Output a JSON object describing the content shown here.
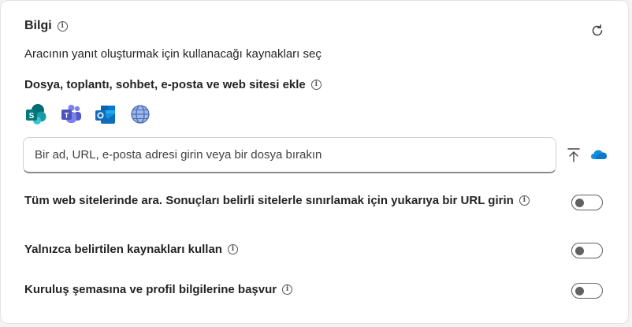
{
  "header": {
    "title": "Bilgi",
    "info_icon": "info-icon",
    "refresh_icon": "refresh-icon"
  },
  "subtitle": "Aracının yanıt oluşturmak için kullanacağı kaynakları seç",
  "add_section": {
    "label": "Dosya, toplantı, sohbet, e-posta ve web sitesi ekle",
    "sources": [
      "sharepoint-icon",
      "teams-icon",
      "outlook-icon",
      "globe-icon"
    ]
  },
  "search": {
    "placeholder": "Bir ad, URL, e-posta adresi girin veya bir dosya bırakın",
    "value": "",
    "upload_icon": "upload-icon",
    "cloud_icon": "onedrive-icon"
  },
  "options": [
    {
      "label": "Tüm web sitelerinde ara. Sonuçları belirli sitelerle sınırlamak için yukarıya bir URL girin",
      "on": false
    },
    {
      "label": "Yalnızca belirtilen kaynakları kullan",
      "on": false
    },
    {
      "label": "Kuruluş şemasına ve profil bilgilerine başvur",
      "on": false
    }
  ],
  "colors": {
    "sharepoint": "#03787c",
    "teams": "#5b5fc7",
    "outlook": "#0f6cbd",
    "globe": "#4b6db2",
    "onedrive": "#0364b8"
  }
}
